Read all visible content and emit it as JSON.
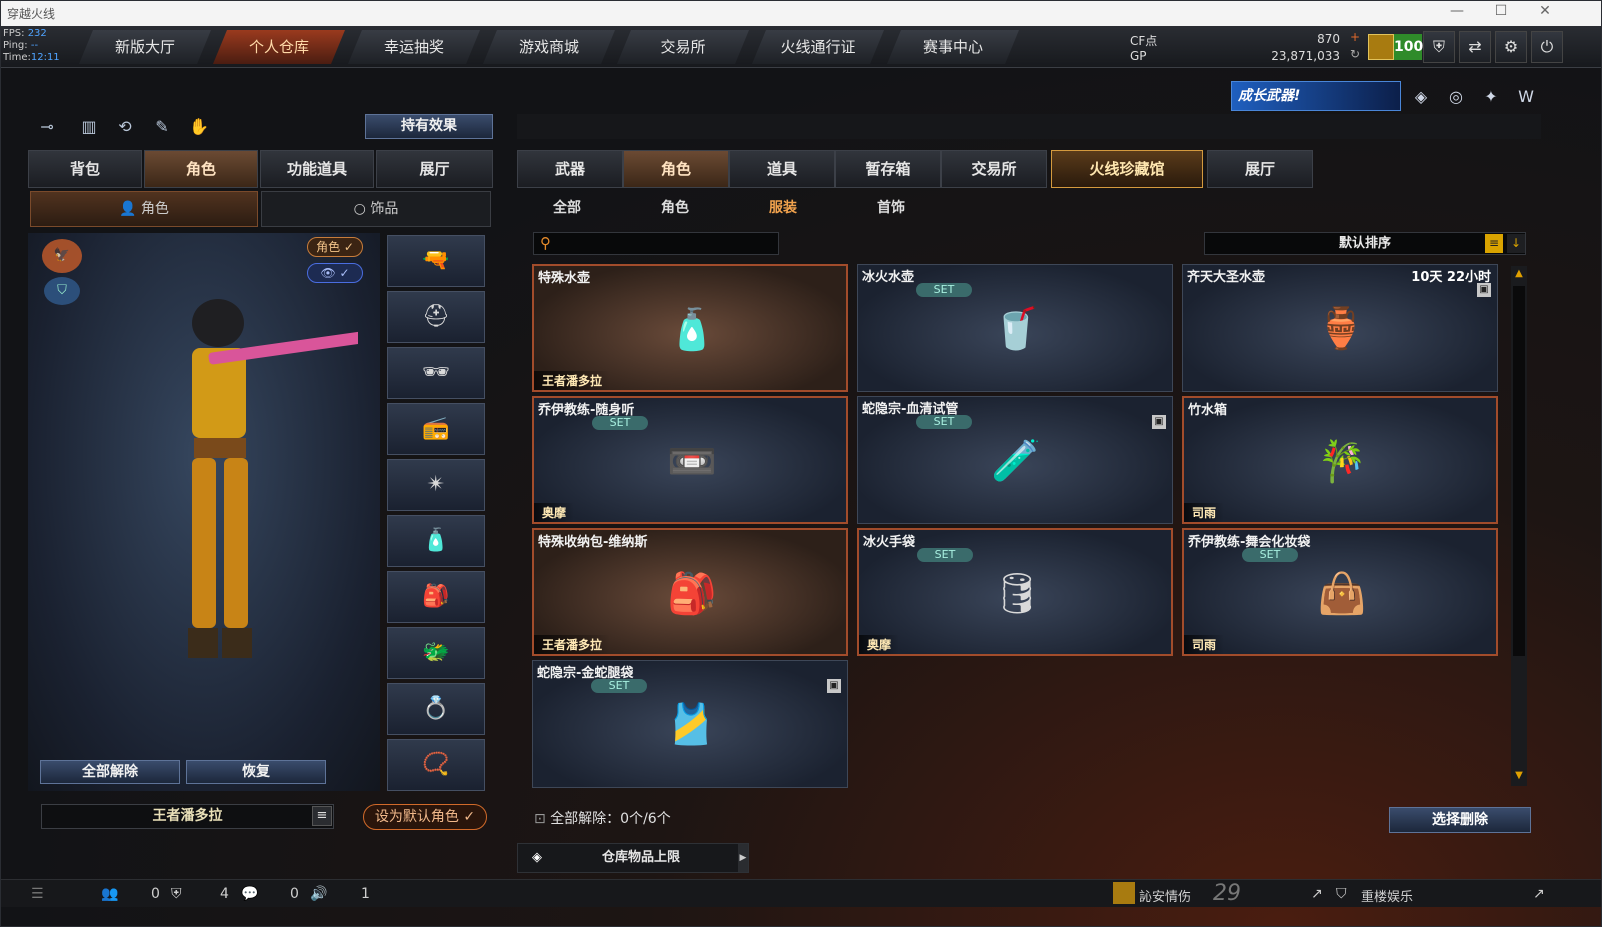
{
  "window": {
    "title": "穿越火线",
    "controls": [
      "—",
      "☐",
      "✕"
    ]
  },
  "stats": {
    "fps_label": "FPS:",
    "fps": "232",
    "ping_label": "Ping:",
    "ping": "--",
    "time_label": "Time:",
    "time": "12:11"
  },
  "nav": {
    "tabs": [
      "新版大厅",
      "个人仓库",
      "幸运抽奖",
      "游戏商城",
      "交易所",
      "火线通行证",
      "赛事中心"
    ],
    "active": 1
  },
  "currency": {
    "cf_label": "CF点",
    "cf_value": "870",
    "gp_label": "GP",
    "gp_value": "23,871,033",
    "level": "100"
  },
  "banner": {
    "text": "成长武器!"
  },
  "left": {
    "effect_button": "持有效果",
    "tabs": [
      "背包",
      "角色",
      "功能道具",
      "展厅"
    ],
    "subtabs": [
      "角色",
      "饰品"
    ],
    "pills": {
      "role": "角色 ✓",
      "view": "👁 ✓"
    },
    "unequip_all": "全部解除",
    "restore": "恢复",
    "character_name": "王者潘多拉",
    "set_default": "设为默认角色 ✓"
  },
  "right": {
    "tabs": [
      "武器",
      "角色",
      "道具",
      "暂存箱",
      "交易所",
      "火线珍藏馆",
      "展厅"
    ],
    "subtabs": [
      "全部",
      "角色",
      "服装",
      "首饰"
    ],
    "sort_label": "默认排序",
    "items": [
      {
        "name": "特殊水壶",
        "owner": "王者潘多拉",
        "set": "",
        "time": "",
        "lock": false,
        "style": "brown",
        "icon": "🧴"
      },
      {
        "name": "冰火水壶",
        "owner": "",
        "set": "SET",
        "time": "",
        "lock": false,
        "style": "plain",
        "icon": "🥤"
      },
      {
        "name": "齐天大圣水壶",
        "owner": "",
        "set": "",
        "time": "10天 22小时",
        "lock": true,
        "style": "plain",
        "icon": "🏺"
      },
      {
        "name": "乔伊教练-随身听",
        "owner": "奥摩",
        "set": "SET",
        "time": "",
        "lock": false,
        "style": "orange",
        "icon": "📼"
      },
      {
        "name": "蛇隐宗-血清试管",
        "owner": "",
        "set": "SET",
        "time": "",
        "lock": true,
        "style": "plain",
        "icon": "🧪"
      },
      {
        "name": "竹水箱",
        "owner": "司雨",
        "set": "",
        "time": "",
        "lock": false,
        "style": "orange",
        "icon": "🎋"
      },
      {
        "name": "特殊收纳包-维纳斯",
        "owner": "王者潘多拉",
        "set": "",
        "time": "",
        "lock": false,
        "style": "brown",
        "icon": "🎒"
      },
      {
        "name": "冰火手袋",
        "owner": "奥摩",
        "set": "SET",
        "time": "",
        "lock": false,
        "style": "orange",
        "icon": "🛢"
      },
      {
        "name": "乔伊教练-舞会化妆袋",
        "owner": "司雨",
        "set": "SET",
        "time": "",
        "lock": false,
        "style": "orange",
        "icon": "👜"
      },
      {
        "name": "蛇隐宗-金蛇腿袋",
        "owner": "",
        "set": "SET",
        "time": "",
        "lock": true,
        "style": "plain",
        "icon": "🎽"
      }
    ],
    "unequip_info": "全部解除：0个/6个",
    "delete_button": "选择删除",
    "capacity": "仓库物品上限"
  },
  "status": {
    "friends": "0",
    "clan": "4",
    "chat": "0",
    "volume": "1",
    "user1": "訫安情伤",
    "user1_rank": "29",
    "user2": "重楼娱乐"
  }
}
